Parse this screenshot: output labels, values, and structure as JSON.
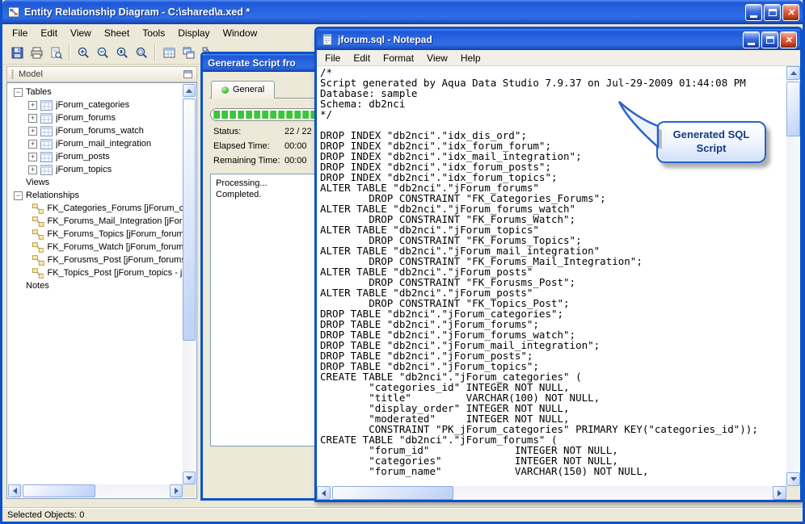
{
  "colors": {
    "window_bg": "#ece9d8",
    "titlebar_blue": "#2a66e2",
    "progress_green": "#3ec43e",
    "callout_border": "#2a63c8",
    "callout_text": "#17397e"
  },
  "main_window": {
    "title": "Entity Relationship Diagram - C:\\shared\\a.xed *",
    "menus": [
      "File",
      "Edit",
      "View",
      "Sheet",
      "Tools",
      "Display",
      "Window"
    ],
    "status_bar": "Selected Objects: 0"
  },
  "model_panel": {
    "title": "Model",
    "tree": {
      "tables_label": "Tables",
      "tables": [
        "jForum_categories",
        "jForum_forums",
        "jForum_forums_watch",
        "jForum_mail_integration",
        "jForum_posts",
        "jForum_topics"
      ],
      "views_label": "Views",
      "relationships_label": "Relationships",
      "relationships": [
        "FK_Categories_Forums [jForum_ca",
        "FK_Forums_Mail_Integration [jForu",
        "FK_Forums_Topics [jForum_forums",
        "FK_Forums_Watch [jForum_forums",
        "FK_Forusms_Post [jForum_forums",
        "FK_Topics_Post [jForum_topics - jF"
      ],
      "notes_label": "Notes"
    }
  },
  "generate_dialog": {
    "title": "Generate Script fro",
    "tab_general": "General",
    "rows": [
      {
        "label": "Status:",
        "value": "22 / 22"
      },
      {
        "label": "Elapsed Time:",
        "value": "00:00"
      },
      {
        "label": "Remaining Time:",
        "value": "00:00"
      }
    ],
    "log": [
      "Processing...",
      "Completed."
    ]
  },
  "notepad": {
    "title": "jforum.sql - Notepad",
    "menus": [
      "File",
      "Edit",
      "Format",
      "View",
      "Help"
    ],
    "content": "/*\nScript generated by Aqua Data Studio 7.9.37 on Jul-29-2009 01:44:08 PM\nDatabase: sample\nSchema: db2nci\n*/\n\nDROP INDEX \"db2nci\".\"idx_dis_ord\";\nDROP INDEX \"db2nci\".\"idx_forum_forum\";\nDROP INDEX \"db2nci\".\"idx_mail_integration\";\nDROP INDEX \"db2nci\".\"idx_forum_posts\";\nDROP INDEX \"db2nci\".\"idx_forum_topics\";\nALTER TABLE \"db2nci\".\"jForum_forums\"\n        DROP CONSTRAINT \"FK_Categories_Forums\";\nALTER TABLE \"db2nci\".\"jForum_forums_watch\"\n        DROP CONSTRAINT \"FK_Forums_Watch\";\nALTER TABLE \"db2nci\".\"jForum_topics\"\n        DROP CONSTRAINT \"FK_Forums_Topics\";\nALTER TABLE \"db2nci\".\"jForum_mail_integration\"\n        DROP CONSTRAINT \"FK_Forums_Mail_Integration\";\nALTER TABLE \"db2nci\".\"jForum_posts\"\n        DROP CONSTRAINT \"FK_Forusms_Post\";\nALTER TABLE \"db2nci\".\"jForum_posts\"\n        DROP CONSTRAINT \"FK_Topics_Post\";\nDROP TABLE \"db2nci\".\"jForum_categories\";\nDROP TABLE \"db2nci\".\"jForum_forums\";\nDROP TABLE \"db2nci\".\"jForum_forums_watch\";\nDROP TABLE \"db2nci\".\"jForum_mail_integration\";\nDROP TABLE \"db2nci\".\"jForum_posts\";\nDROP TABLE \"db2nci\".\"jForum_topics\";\nCREATE TABLE \"db2nci\".\"jForum_categories\" (\n        \"categories_id\" INTEGER NOT NULL,\n        \"title\"         VARCHAR(100) NOT NULL,\n        \"display_order\" INTEGER NOT NULL,\n        \"moderated\"     INTEGER NOT NULL,\n        CONSTRAINT \"PK_jForum_categories\" PRIMARY KEY(\"categories_id\"));\nCREATE TABLE \"db2nci\".\"jForum_forums\" (\n        \"forum_id\"              INTEGER NOT NULL,\n        \"categories\"            INTEGER NOT NULL,\n        \"forum_name\"            VARCHAR(150) NOT NULL,"
  },
  "callout": {
    "text": "Generated SQL Script"
  }
}
